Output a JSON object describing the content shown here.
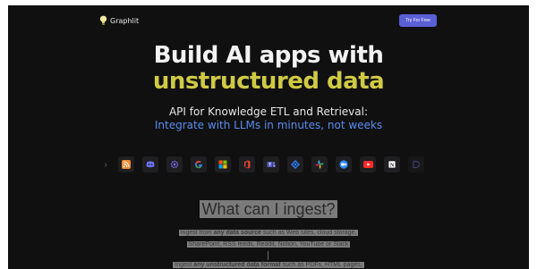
{
  "nav": {
    "brand": "Graphlit",
    "cta_label": "Try For Free"
  },
  "hero": {
    "title_line1": "Build AI apps with",
    "title_line2": "unstructured data",
    "subtitle_line1": "API for Knowledge ETL and Retrieval:",
    "subtitle_line2": "Integrate with LLMs in minutes, not weeks"
  },
  "integrations": {
    "prev_icon": "chevron-left-icon",
    "items": [
      {
        "name": "rss-icon",
        "color": "#f28b30"
      },
      {
        "name": "discord-icon",
        "color": "#6d72f5"
      },
      {
        "name": "settings-icon",
        "color": "#7b6cf0"
      },
      {
        "name": "google-icon",
        "color": "#4285f4"
      },
      {
        "name": "microsoft-icon",
        "color": "#f35325"
      },
      {
        "name": "office-icon",
        "color": "#e8462c"
      },
      {
        "name": "teams-icon",
        "color": "#6264a7"
      },
      {
        "name": "jira-icon",
        "color": "#2b7cf0"
      },
      {
        "name": "slack-icon",
        "color": "#e01e5a"
      },
      {
        "name": "zoom-icon",
        "color": "#2d8cff"
      },
      {
        "name": "youtube-icon",
        "color": "#ff2a2a"
      },
      {
        "name": "notion-icon",
        "color": "#e6e6e6"
      },
      {
        "name": "more-icon",
        "color": "#6a6ad0"
      }
    ]
  },
  "ingest": {
    "title": "What can I ingest?",
    "desc_line1_pre": "Ingest from ",
    "desc_line1_em": "any data source",
    "desc_line1_post": " such as Web sites, cloud storage,",
    "desc_line2": "SharePoint, RSS feeds, Reddit, Notion, YouTube or Slack",
    "desc_line3_pre": "Ingest ",
    "desc_line3_em": "any unstructured data format",
    "desc_line3_post": " such as PDFs, HTML pages,"
  }
}
